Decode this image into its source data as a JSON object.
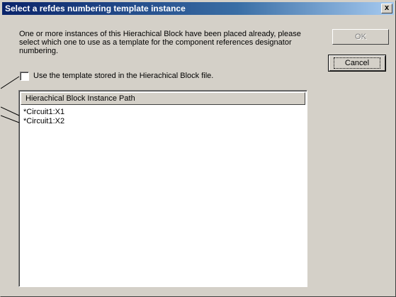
{
  "window": {
    "title": "Select a refdes numbering template instance",
    "close_glyph": "x"
  },
  "message": "One or more instances of this Hierachical Block have been placed already, please select which one to use as a template for the component references designator numbering.",
  "buttons": {
    "ok_label": "OK",
    "cancel_label": "Cancel"
  },
  "checkbox": {
    "label": "Use the template stored in the Hierachical Block file.",
    "checked": false
  },
  "list": {
    "column_header": "Hierachical Block Instance Path",
    "rows": [
      "*Circuit1:X1",
      "*Circuit1:X2"
    ]
  },
  "colors": {
    "dialog_face": "#d4d0c8",
    "title_active": "#0a246a",
    "title_gradient_end": "#a6caf0",
    "disabled_text": "#808080"
  },
  "icons": {
    "close": "close-icon"
  }
}
